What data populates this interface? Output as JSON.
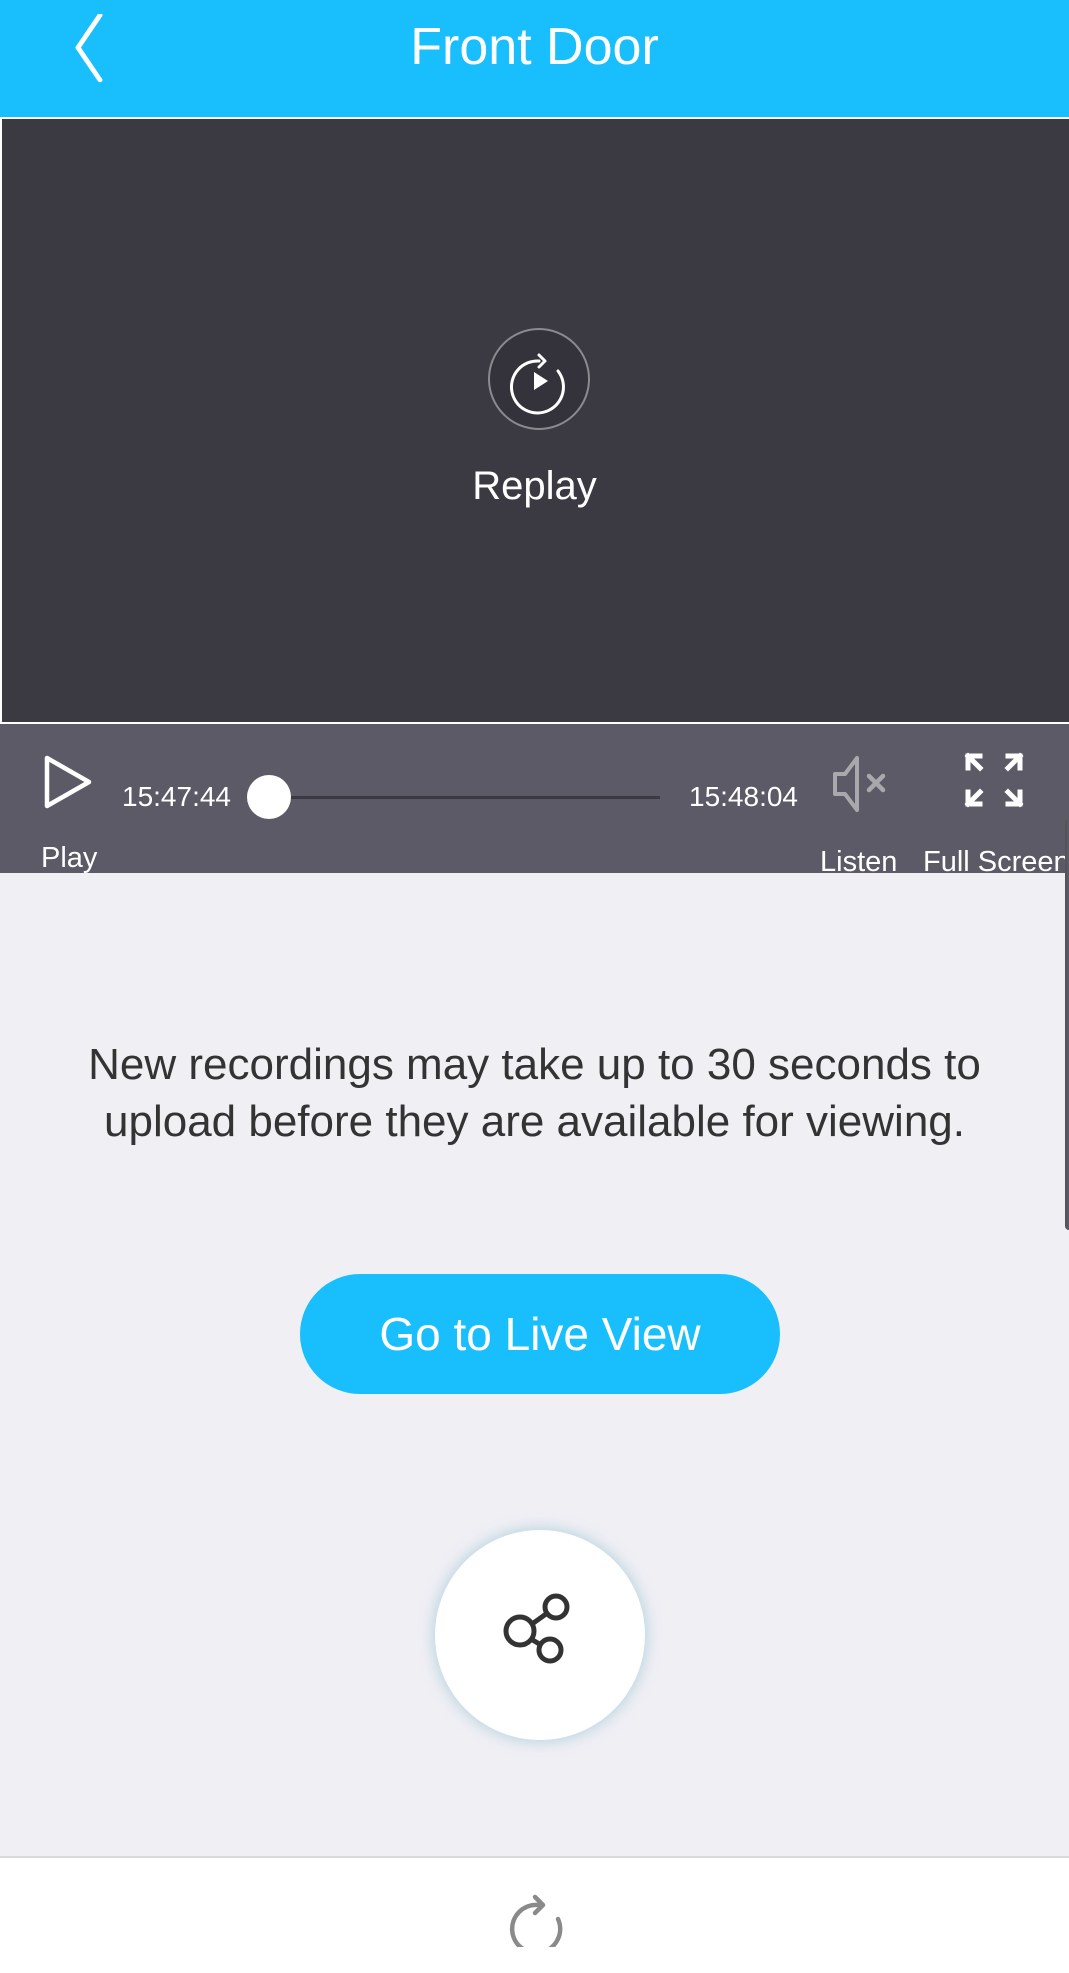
{
  "header": {
    "title": "Front Door",
    "back_icon": "chevron-left-icon",
    "bg_color": "#18bffc"
  },
  "video": {
    "replay_label": "Replay",
    "replay_icon": "replay-icon"
  },
  "controls": {
    "play_label": "Play",
    "play_icon": "play-icon",
    "start_time": "15:47:44",
    "end_time": "15:48:04",
    "progress": 0,
    "listen_label": "Listen",
    "listen_icon": "speaker-muted-icon",
    "fullscreen_label": "Full Screen",
    "fullscreen_icon": "fullscreen-icon"
  },
  "main": {
    "notice": "New recordings may take up to 30 seconds to upload before they are available for viewing.",
    "live_view_label": "Go to Live View",
    "share_icon": "share-icon",
    "accent_color": "#18bffc"
  },
  "bottom": {
    "refresh_icon": "refresh-icon"
  }
}
